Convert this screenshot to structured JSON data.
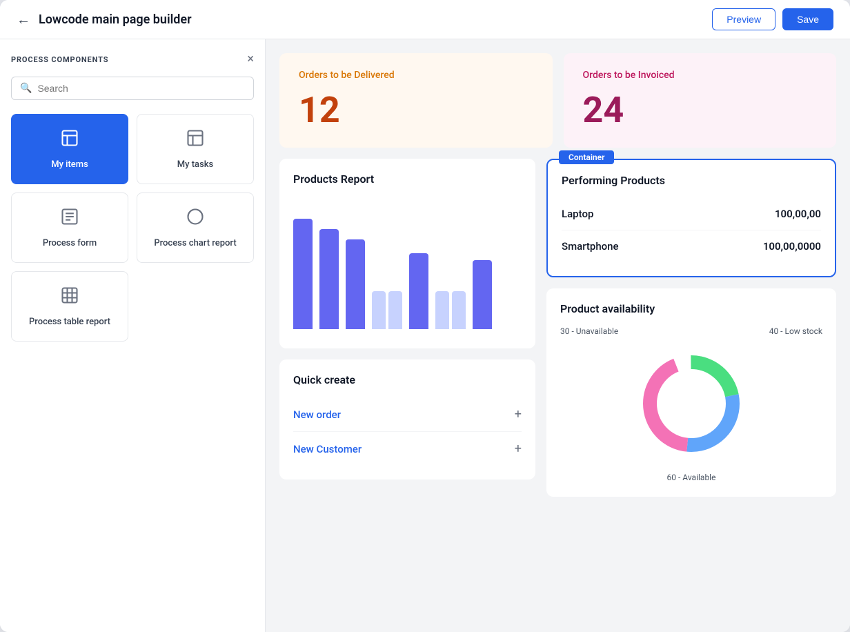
{
  "header": {
    "title": "Lowcode main page builder",
    "back_label": "←",
    "preview_label": "Preview",
    "save_label": "Save"
  },
  "sidebar": {
    "title": "PROCESS COMPONENTS",
    "search_placeholder": "Search",
    "close_label": "×",
    "components": [
      {
        "id": "my-items",
        "label": "My items",
        "icon": "☰",
        "active": true
      },
      {
        "id": "my-tasks",
        "label": "My tasks",
        "icon": "☰",
        "active": false
      },
      {
        "id": "process-form",
        "label": "Process form",
        "icon": "⊞",
        "active": false
      },
      {
        "id": "process-chart-report",
        "label": "Process chart report",
        "icon": "◎",
        "active": false
      },
      {
        "id": "process-table-report",
        "label": "Process table report",
        "icon": "▦",
        "active": false
      }
    ]
  },
  "canvas": {
    "stat_cards": [
      {
        "id": "orders-deliver",
        "label": "Orders to be Delivered",
        "value": "12",
        "theme": "deliver"
      },
      {
        "id": "orders-invoice",
        "label": "Orders to be Invoiced",
        "value": "24",
        "theme": "invoice"
      }
    ],
    "products_report": {
      "title": "Products Report",
      "bars": [
        {
          "dark_h": 160,
          "light_h": 0
        },
        {
          "dark_h": 145,
          "light_h": 0
        },
        {
          "dark_h": 130,
          "light_h": 0
        },
        {
          "dark_h": 55,
          "light_h": 0
        },
        {
          "dark_h": 110,
          "light_h": 55
        },
        {
          "dark_h": 110,
          "light_h": 55
        },
        {
          "dark_h": 100,
          "light_h": 0
        }
      ]
    },
    "quick_create": {
      "title": "Quick create",
      "items": [
        {
          "label": "New order",
          "icon": "+"
        },
        {
          "label": "New Customer",
          "icon": "+"
        }
      ]
    },
    "performing_products": {
      "title": "Performing Products",
      "badge": "Container",
      "products": [
        {
          "name": "Laptop",
          "value": "100,00,00"
        },
        {
          "name": "Smartphone",
          "value": "100,00,0000"
        }
      ]
    },
    "product_availability": {
      "title": "Product availability",
      "segments": [
        {
          "label": "30 - Unavailable",
          "color": "#4ade80",
          "value": 30
        },
        {
          "label": "40 - Low stock",
          "color": "#60a5fa",
          "value": 40
        },
        {
          "label": "60 - Available",
          "color": "#f472b6",
          "value": 60
        }
      ]
    }
  }
}
